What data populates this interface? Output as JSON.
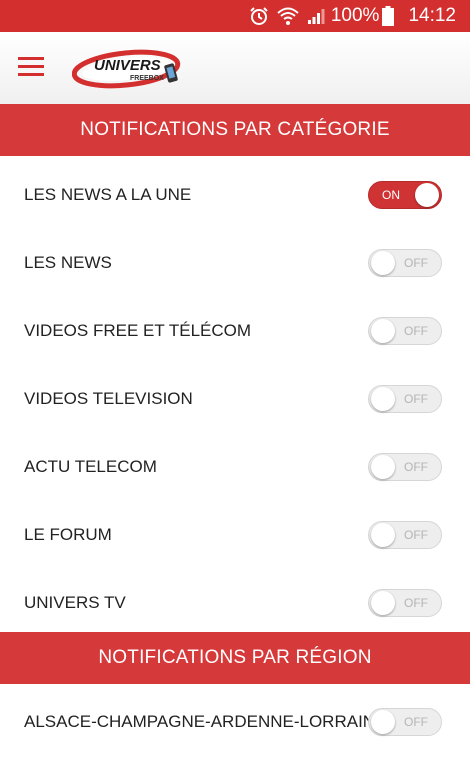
{
  "status_bar": {
    "icons": [
      "alarm-icon",
      "wifi-icon",
      "signal-icon",
      "battery-icon"
    ],
    "battery": "100%",
    "time": "14:12",
    "color": "#d32f2f"
  },
  "app_bar": {
    "menu_icon": "hamburger-menu-icon",
    "logo": {
      "main_text": "UNIVERS",
      "sub_text": "FREEBOX"
    }
  },
  "sections": [
    {
      "title": "NOTIFICATIONS PAR CATÉGORIE",
      "items": [
        {
          "label": "LES NEWS A LA UNE",
          "state": "ON"
        },
        {
          "label": "LES NEWS",
          "state": "OFF"
        },
        {
          "label": "VIDEOS FREE ET TÉLÉCOM",
          "state": "OFF"
        },
        {
          "label": "VIDEOS TELEVISION",
          "state": "OFF"
        },
        {
          "label": "ACTU TELECOM",
          "state": "OFF"
        },
        {
          "label": "LE FORUM",
          "state": "OFF"
        },
        {
          "label": "UNIVERS TV",
          "state": "OFF"
        }
      ]
    },
    {
      "title": "NOTIFICATIONS PAR RÉGION",
      "items": [
        {
          "label": "ALSACE-CHAMPAGNE-ARDENNE-LORRAINE",
          "state": "OFF"
        }
      ]
    }
  ],
  "colors": {
    "accent": "#d32f2f",
    "header": "#d6393a",
    "toggle_on": "#cf3333",
    "toggle_off": "#eeeeee"
  }
}
